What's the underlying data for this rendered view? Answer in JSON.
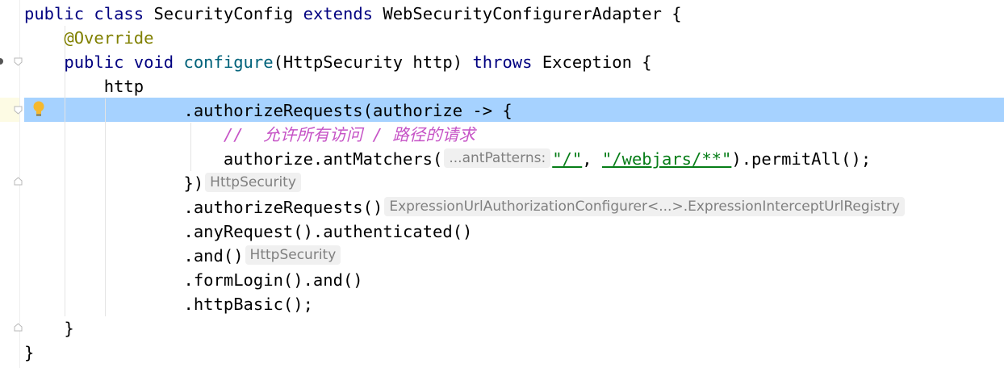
{
  "editor": {
    "lines": [
      {
        "kw1": "public",
        "kw2": "class",
        "name": "SecurityConfig",
        "kw3": "extends",
        "parent": "WebSecurityConfigurerAdapter",
        "brace": "{"
      },
      {
        "annotation": "@Override"
      },
      {
        "kw1": "public",
        "kw2": "void",
        "method": "configure",
        "params_open": "(HttpSecurity http)",
        "kw3": "throws",
        "exc": "Exception {"
      },
      {
        "text": "http"
      },
      {
        "text": ".authorizeRequests(authorize -> {"
      },
      {
        "comment": "//  允许所有访问 / 路径的请求"
      },
      {
        "pre": "authorize.antMatchers(",
        "hint": "...antPatterns:",
        "s1": "\"/\"",
        "sep": ", ",
        "s2": "\"/webjars/**\"",
        "post": ").permitAll();"
      },
      {
        "text": "})",
        "hint": "HttpSecurity"
      },
      {
        "text": ".authorizeRequests()",
        "hint": "ExpressionUrlAuthorizationConfigurer<...>.ExpressionInterceptUrlRegistry"
      },
      {
        "text": ".anyRequest().authenticated()"
      },
      {
        "text": ".and()",
        "hint": "HttpSecurity"
      },
      {
        "text": ".formLogin().and()"
      },
      {
        "text": ".httpBasic();"
      },
      {
        "text": "}"
      },
      {
        "text": "}"
      }
    ]
  },
  "icons": {
    "intention": "lightbulb-icon",
    "fold": "fold-marker-icon"
  },
  "colors": {
    "keyword": "#000080",
    "annotation": "#808000",
    "method": "#00627a",
    "string": "#067d17",
    "comment": "#c653c6",
    "highlight": "#a6d2ff"
  }
}
